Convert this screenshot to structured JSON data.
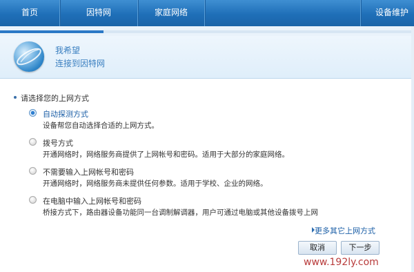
{
  "nav": {
    "items": [
      "首页",
      "因特网",
      "家庭网络",
      "设备维护"
    ]
  },
  "progress": {
    "fraction": 0.25
  },
  "header": {
    "title": "我希望",
    "subtitle": "连接到因特网"
  },
  "prompt": "请选择您的上网方式",
  "options": [
    {
      "title": "自动探测方式",
      "desc": "设备帮您自动选择合适的上网方式。",
      "selected": true
    },
    {
      "title": "拨号方式",
      "desc": "开通网络时，网络服务商提供了上网帐号和密码。适用于大部分的家庭网络。",
      "selected": false
    },
    {
      "title": "不需要输入上网帐号和密码",
      "desc": "开通网络时，网络服务商未提供任何参数。适用于学校、企业的网络。",
      "selected": false
    },
    {
      "title": "在电脑中输入上网帐号和密码",
      "desc": "桥接方式下，路由器设备功能同一台调制解调器，用户可通过电脑或其他设备拨号上网",
      "selected": false
    }
  ],
  "more_link": "更多其它上网方式",
  "buttons": {
    "cancel": "取消",
    "next": "下一步"
  },
  "watermark": "www.192ly.com",
  "colors": {
    "nav": "#1f6fb8",
    "accent": "#2b79c6",
    "link": "#1a5ea6"
  }
}
